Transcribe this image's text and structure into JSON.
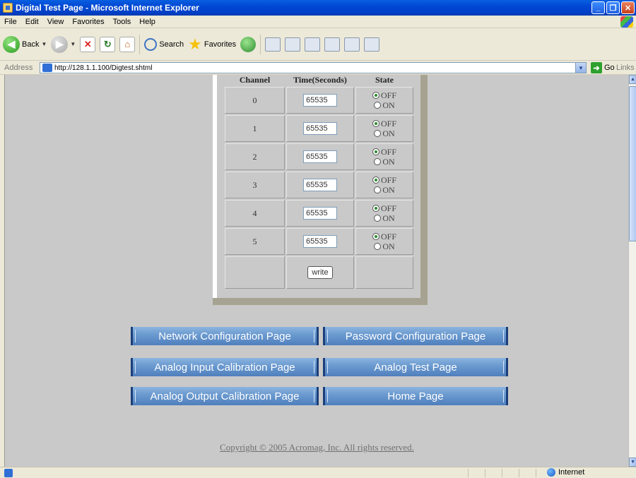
{
  "window": {
    "title": "Digital Test Page - Microsoft Internet Explorer"
  },
  "menu": [
    "File",
    "Edit",
    "View",
    "Favorites",
    "Tools",
    "Help"
  ],
  "toolbar": {
    "back_label": "Back",
    "search_label": "Search",
    "favorites_label": "Favorites"
  },
  "address": {
    "label": "Address",
    "url": "http://128.1.1.100/Digtest.shtml",
    "go_label": "Go",
    "links_label": "Links"
  },
  "table": {
    "headers": [
      "Channel",
      "Time(Seconds)",
      "State"
    ],
    "rows": [
      {
        "channel": "0",
        "time": "65535",
        "state": "OFF"
      },
      {
        "channel": "1",
        "time": "65535",
        "state": "OFF"
      },
      {
        "channel": "2",
        "time": "65535",
        "state": "OFF"
      },
      {
        "channel": "3",
        "time": "65535",
        "state": "OFF"
      },
      {
        "channel": "4",
        "time": "65535",
        "state": "OFF"
      },
      {
        "channel": "5",
        "time": "65535",
        "state": "OFF"
      }
    ],
    "state_options": [
      "OFF",
      "ON"
    ],
    "write_label": "write"
  },
  "nav": {
    "network": "Network Configuration Page",
    "password": "Password Configuration Page",
    "analog_input_cal": "Analog Input Calibration Page",
    "analog_test": "Analog Test Page",
    "analog_output_cal": "Analog Output Calibration Page",
    "home": "Home Page"
  },
  "footer": {
    "copyright": "Copyright © 2005 Acromag, Inc. All rights reserved."
  },
  "status": {
    "zone": "Internet"
  }
}
